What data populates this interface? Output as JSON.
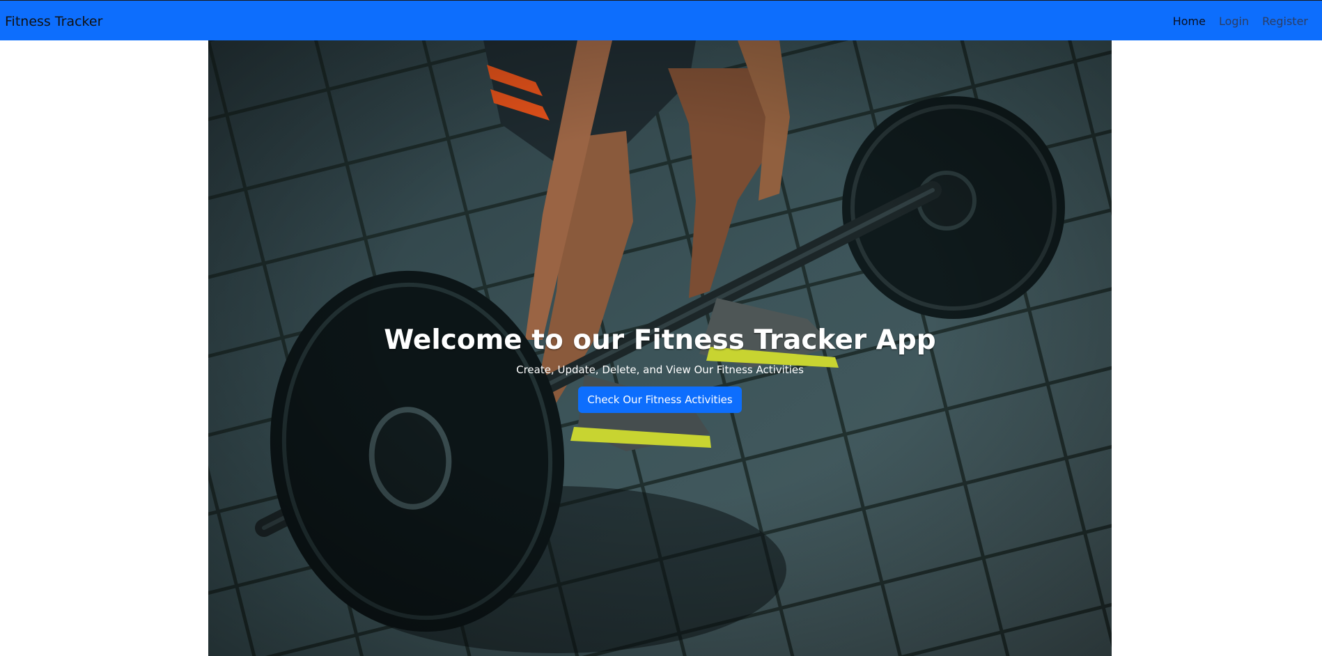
{
  "navbar": {
    "brand": "Fitness Tracker",
    "links": [
      {
        "label": "Home",
        "active": true
      },
      {
        "label": "Login",
        "active": false
      },
      {
        "label": "Register",
        "active": false
      }
    ],
    "background_color": "#0d6efd"
  },
  "hero": {
    "title": "Welcome to our Fitness Tracker App",
    "subtitle": "Create, Update, Delete, and View Our Fitness Activities",
    "button_label": "Check Our Fitness Activities",
    "image_subject": "deadlift-barbell-gym-photo"
  },
  "colors": {
    "accent": "#0d6efd",
    "hero_text": "#ffffff"
  }
}
